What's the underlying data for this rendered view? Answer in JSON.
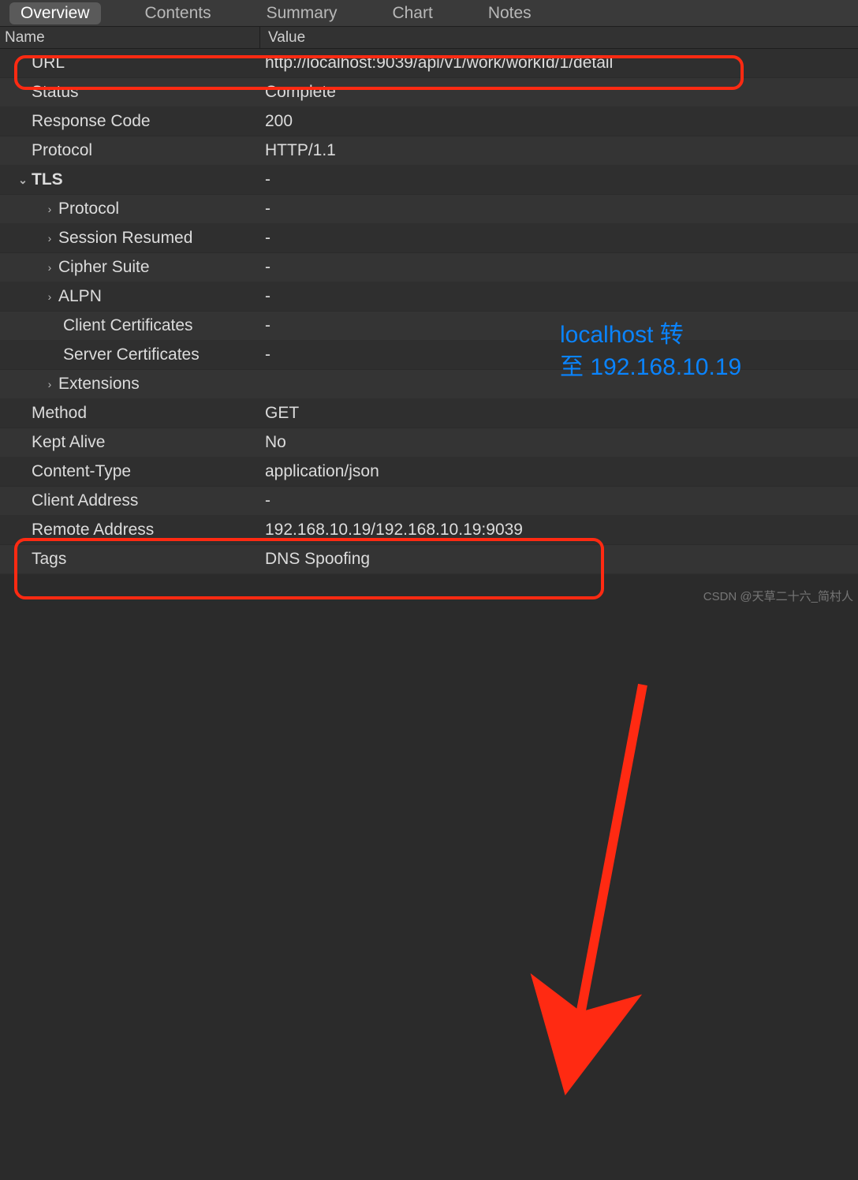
{
  "tabs": {
    "items": [
      {
        "label": "Overview",
        "active": true
      },
      {
        "label": "Contents",
        "active": false
      },
      {
        "label": "Summary",
        "active": false
      },
      {
        "label": "Chart",
        "active": false
      },
      {
        "label": "Notes",
        "active": false
      }
    ]
  },
  "columns": {
    "name": "Name",
    "value": "Value"
  },
  "rows": [
    {
      "key": "URL",
      "value": "http://localhost:9039/api/v1/work/workId/1/detail",
      "indent": "pad0"
    },
    {
      "key": "Status",
      "value": "Complete",
      "indent": "pad0"
    },
    {
      "key": "Response Code",
      "value": "200",
      "indent": "pad0"
    },
    {
      "key": "Protocol",
      "value": "HTTP/1.1",
      "indent": "pad0"
    },
    {
      "key": "TLS",
      "value": "-",
      "indent": "pad1",
      "chev": "down",
      "bold": true
    },
    {
      "key": "Protocol",
      "value": "-",
      "indent": "pad2",
      "chev": "right"
    },
    {
      "key": "Session Resumed",
      "value": "-",
      "indent": "pad2",
      "chev": "right"
    },
    {
      "key": "Cipher Suite",
      "value": "-",
      "indent": "pad2",
      "chev": "right"
    },
    {
      "key": "ALPN",
      "value": "-",
      "indent": "pad2",
      "chev": "right"
    },
    {
      "key": "Client Certificates",
      "value": "-",
      "indent": "pad2b"
    },
    {
      "key": "Server Certificates",
      "value": "-",
      "indent": "pad2b"
    },
    {
      "key": "Extensions",
      "value": "",
      "indent": "pad2",
      "chev": "right"
    },
    {
      "key": "Method",
      "value": "GET",
      "indent": "pad0"
    },
    {
      "key": "Kept Alive",
      "value": "No",
      "indent": "pad0"
    },
    {
      "key": "Content-Type",
      "value": "application/json",
      "indent": "pad0"
    },
    {
      "key": "Client Address",
      "value": "-",
      "indent": "pad0"
    },
    {
      "key": "Remote Address",
      "value": "192.168.10.19/192.168.10.19:9039",
      "indent": "pad0"
    },
    {
      "key": "Tags",
      "value": "DNS Spoofing",
      "indent": "pad0"
    }
  ],
  "annotation": {
    "text_line1": "localhost 转",
    "text_line2": "至 192.168.10.19",
    "watermark": "CSDN @天草二十六_简村人"
  },
  "colors": {
    "accent_red": "#ff2a12",
    "accent_blue": "#0a84ff"
  }
}
